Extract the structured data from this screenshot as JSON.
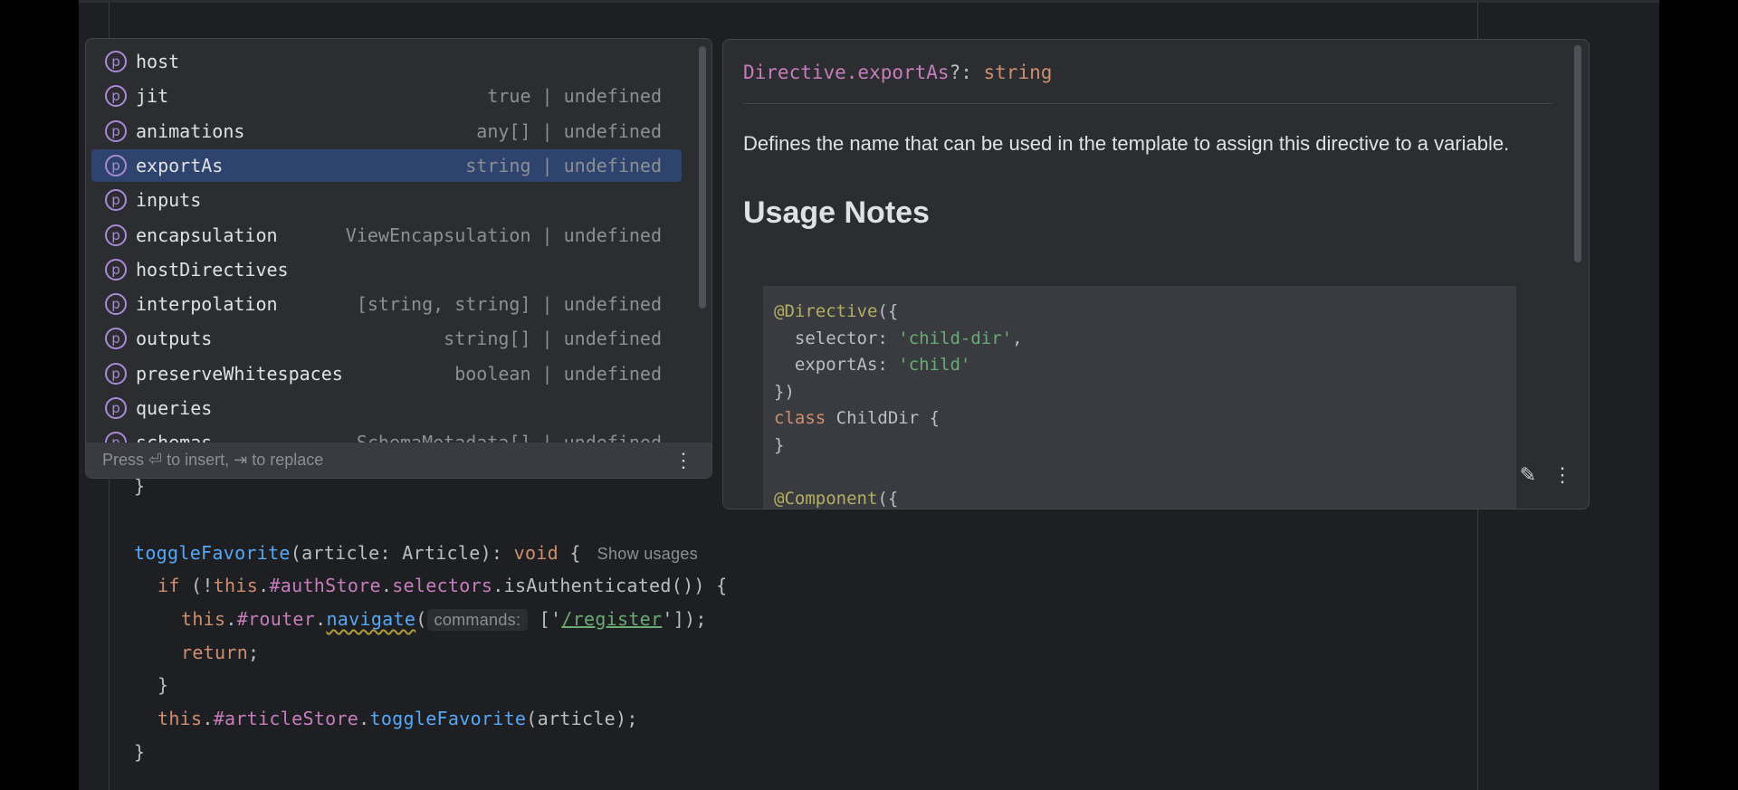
{
  "completion": {
    "items": [
      {
        "name": "host",
        "type": ""
      },
      {
        "name": "jit",
        "type": "true | undefined"
      },
      {
        "name": "animations",
        "type": "any[] | undefined"
      },
      {
        "name": "exportAs",
        "type": "string | undefined",
        "selected": true
      },
      {
        "name": "inputs",
        "type": ""
      },
      {
        "name": "encapsulation",
        "type": "ViewEncapsulation | undefined"
      },
      {
        "name": "hostDirectives",
        "type": ""
      },
      {
        "name": "interpolation",
        "type": "[string, string] | undefined"
      },
      {
        "name": "outputs",
        "type": "string[] | undefined"
      },
      {
        "name": "preserveWhitespaces",
        "type": "boolean | undefined"
      },
      {
        "name": "queries",
        "type": ""
      },
      {
        "name": "schemas",
        "type": "SchemaMetadata[] | undefined"
      }
    ],
    "icon_letter": "p",
    "footer": "Press ⏎ to insert, ⇥ to replace"
  },
  "doc": {
    "signature_name": "Directive.exportAs",
    "signature_sep": "?: ",
    "signature_type": "string",
    "description": "Defines the name that can be used in the template to assign this directive to a variable.",
    "heading": "Usage Notes",
    "code": {
      "l1a": "@Directive",
      "l1b": "({",
      "l2a": "  selector: ",
      "l2b": "'child-dir'",
      "l2c": ",",
      "l3a": "  exportAs: ",
      "l3b": "'child'",
      "l4": "})",
      "l5a": "class",
      "l5b": " ChildDir {",
      "l6": "}",
      "l8a": "@Component",
      "l8b": "({"
    }
  },
  "code": {
    "l0": "}",
    "l1a": "toggleFavorite",
    "l1b": "(article: Article): ",
    "l1c": "void",
    "l1d": " {",
    "l1_hint": "Show usages",
    "l2a": "if",
    "l2b": " (!",
    "l2c": "this",
    ".": ".",
    "l2d": "#authStore",
    "l2e": "selectors",
    "l2f": ".isAuthenticated()) {",
    "l3a": "this",
    "l3b": "#router",
    "l3c": "navigate",
    "l3d": "(",
    "l3_hint": "commands:",
    "l3e": " ['",
    "l3f": "/register",
    "l3g": "']);",
    "l4": "return",
    "l5": "}",
    "l6a": "this",
    "l6b": "#articleStore",
    "l6c": "toggleFavorite",
    "l6d": "(article);",
    "l7": "}"
  }
}
